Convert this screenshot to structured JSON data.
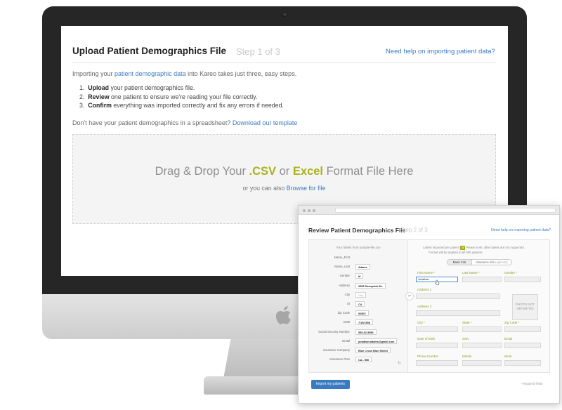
{
  "step1": {
    "title": "Upload Patient Demographics File",
    "step_label": "Step 1 of 3",
    "help_link": "Need help on importing patient data?",
    "intro_before": "Importing your ",
    "intro_link": "patient demographic data",
    "intro_after": " into Kareo takes just three, easy steps.",
    "steps": [
      {
        "num": "1.",
        "bold": "Upload",
        "rest": " your patient demographics file."
      },
      {
        "num": "2.",
        "bold": "Review",
        "rest": " one patient to ensure we're reading your file correctly."
      },
      {
        "num": "3.",
        "bold": "Confirm",
        "rest": " everything was imported correctly and fix any errors if needed."
      }
    ],
    "template_text": "Don't have your patient demographics in a spreadsheet? ",
    "template_link": "Download our template",
    "drop_prefix": "Drag & Drop Your ",
    "drop_csv": ".CSV",
    "drop_or": " or ",
    "drop_excel": "Excel",
    "drop_suffix": " Format File Here",
    "drop_sub_before": "or you can also ",
    "drop_sub_link": "Browse for file",
    "accent_color": "#a9b21d",
    "link_color": "#3a7bbf"
  },
  "step2": {
    "title": "Review Patient Demographics File",
    "step_label": "Step 2 of 3",
    "help_link": "Need help on importing patient data?",
    "left_header": "Your labels from sample-file.csv",
    "mapping": [
      {
        "label": "Name_First",
        "value": ""
      },
      {
        "label": "Name_Last",
        "value": "Adams"
      },
      {
        "label": "Gender",
        "value": "M"
      },
      {
        "label": "Address",
        "value": "3355 Sunnyside Dr."
      },
      {
        "label": "City",
        "value": "City"
      },
      {
        "label": "St",
        "value": "CA"
      },
      {
        "label": "Zip Code",
        "value": "92802"
      },
      {
        "label": "DOB",
        "value": "7/15/1958"
      },
      {
        "label": "Social Security Number",
        "value": "555-52-5555"
      },
      {
        "label": "Email",
        "value": "jonathan.adams@gmail.com"
      },
      {
        "label": "Insurance Company",
        "value": "Blue Cross Blue Shield"
      },
      {
        "label": "Insurance Plan",
        "value": "CA - 550"
      }
    ],
    "right_header_1": "Labels imported per patient",
    "badge": "3",
    "right_header_1b": "Please note, other labels are not supported.",
    "right_header_2": "Format will be applied to all 380 patients",
    "tab_basic": "Basic Info",
    "tab_insurance": "Insurance Info",
    "tab_insurance_opt": "(optional)",
    "fields": {
      "first_name": "First Name *",
      "first_name_value": "Jonathan",
      "last_name": "Last Name *",
      "gender": "Gender *",
      "address1": "Address 1",
      "address2": "Address 2",
      "city": "City *",
      "state": "State *",
      "zip": "Zip Code *",
      "dob": "Date of Birth",
      "ssn": "SSN",
      "email": "Email",
      "phone": "Phone Number",
      "mobile": "Mobile",
      "work": "Work"
    },
    "photo_text": "PHOTO NOT IMPORTED",
    "import_button": "Import my patients",
    "required_note": "* Required fields",
    "icons": {
      "mapping_arrow": "double-arrow-icon",
      "refresh": "refresh-icon",
      "cursor": "cursor-icon"
    }
  },
  "device": {
    "logo": "apple-logo-icon"
  }
}
